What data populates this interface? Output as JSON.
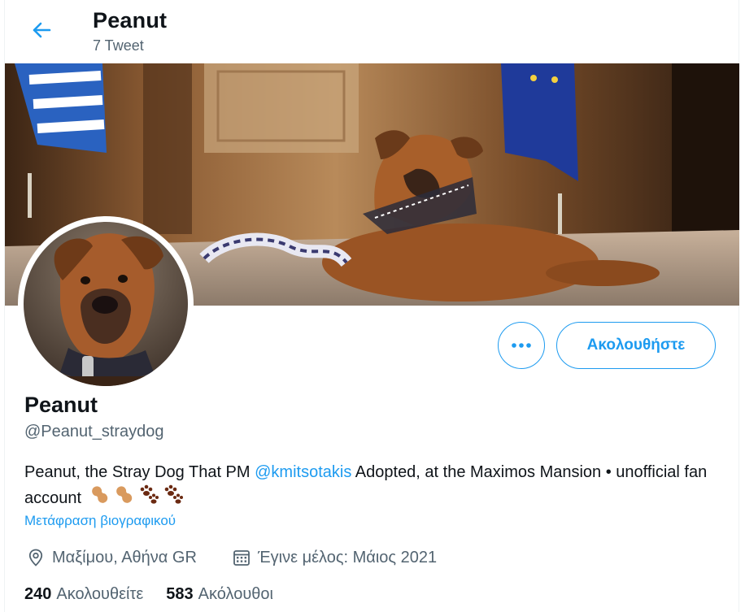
{
  "header": {
    "title": "Peanut",
    "tweet_count": "7 Tweet"
  },
  "profile": {
    "name": "Peanut",
    "handle": "@Peanut_straydog",
    "bio_before": "Peanut, the Stray Dog That PM ",
    "bio_mention": "@kmitsotakis",
    "bio_after": " Adopted, at the Maximos Mansion • unofficial fan account",
    "bio_emojis": [
      "peanut-emoji",
      "peanut-emoji",
      "paw-prints-emoji",
      "paw-prints-emoji"
    ],
    "translate_label": "Μετάφραση βιογραφικού",
    "location": "Μαξίμου, Αθήνα GR",
    "joined": "Έγινε μέλος: Μάιος 2021"
  },
  "stats": {
    "following_count": "240",
    "following_label": "Ακολουθείτε",
    "followers_count": "583",
    "followers_label": "Ακόλουθοι"
  },
  "actions": {
    "follow_label": "Ακολουθήστε"
  },
  "colors": {
    "accent": "#1d9bf0",
    "secondary_text": "#536471",
    "primary_text": "#0f1419"
  }
}
